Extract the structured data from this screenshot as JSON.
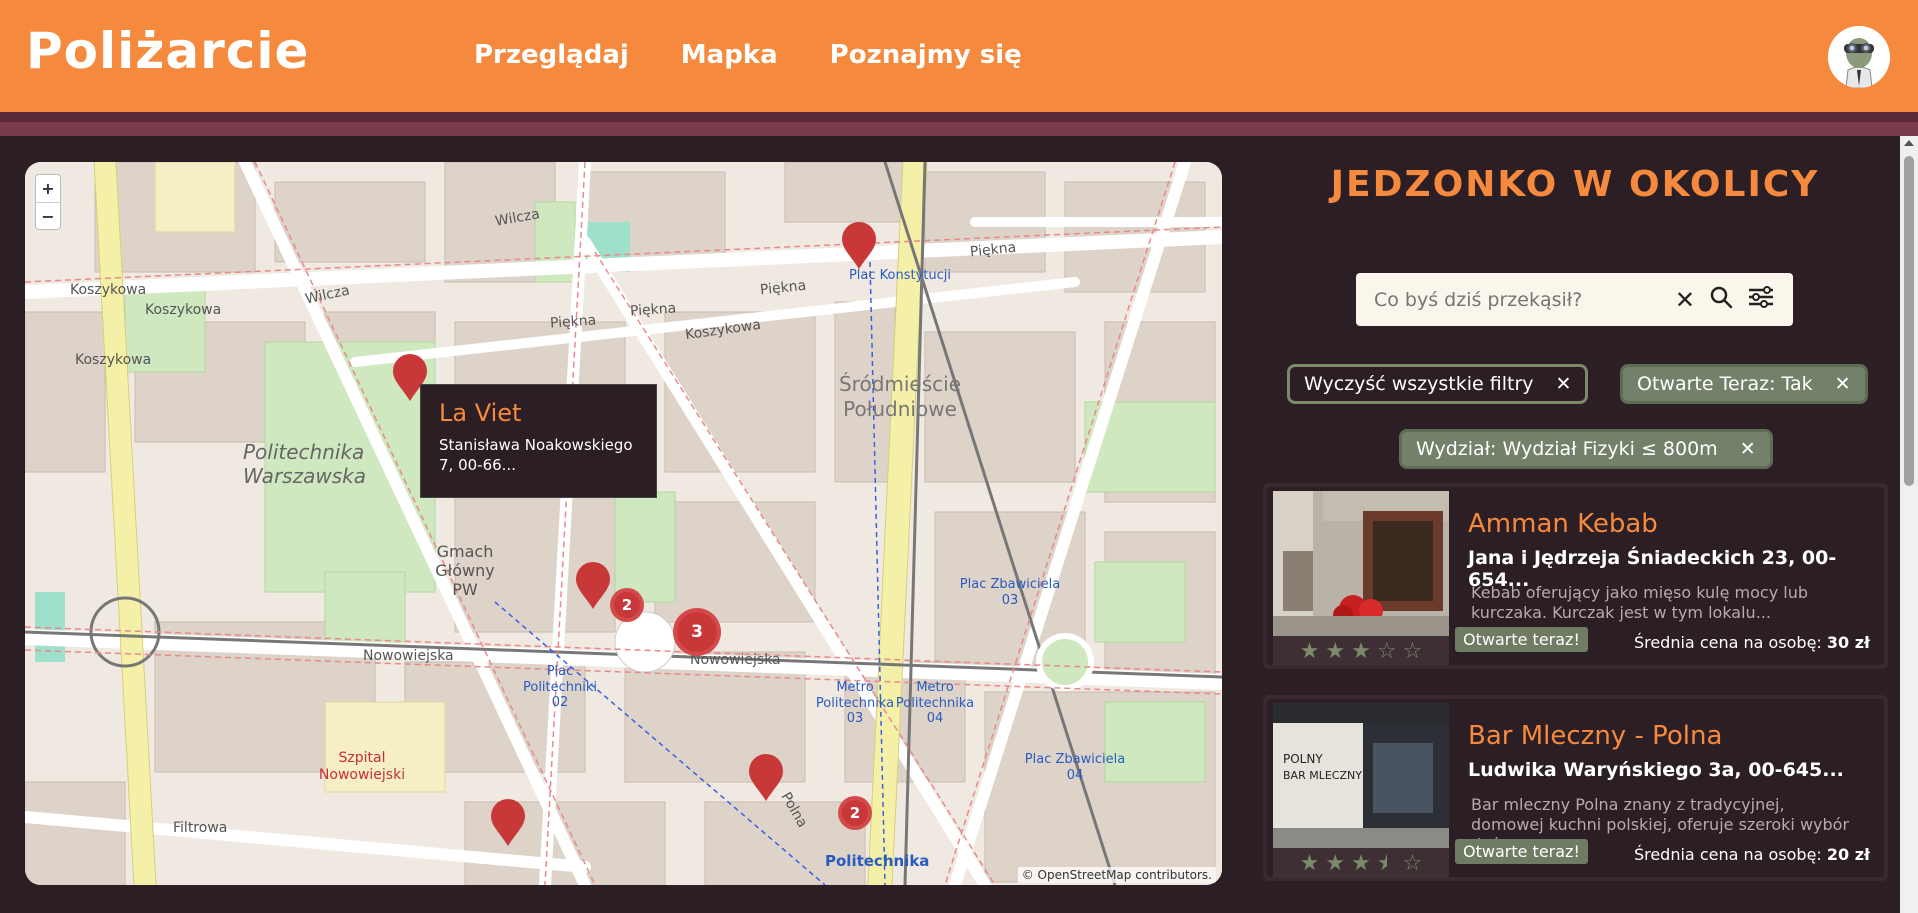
{
  "header": {
    "logo": "Poliżarcie",
    "nav": [
      "Przeglądaj",
      "Mapka",
      "Poznajmy się"
    ]
  },
  "map": {
    "zoom_in": "+",
    "zoom_out": "−",
    "attribution": "© OpenStreetMap contributors.",
    "labels": {
      "koszykowa_1": "Koszykowa",
      "koszykowa_2": "Koszykowa",
      "koszykowa_3": "Koszykowa",
      "koszykowa_4": "Koszykowa",
      "wilcza_1": "Wilcza",
      "wilcza_2": "Wilcza",
      "piekna_1": "Piękna",
      "piekna_2": "Piękna",
      "piekna_3": "Piękna",
      "piekna_4": "Piękna",
      "nowowiejska_1": "Nowowiejska",
      "nowowiejska_2": "Nowowiejska",
      "filtrowa": "Filtrowa",
      "polna": "Polna",
      "politechnika_warszawska": "Politechnika Warszawska",
      "srodmiescie": "Śródmieście Południowe",
      "gmach": "Gmach Główny PW",
      "szpital": "Szpital Nowowiejski",
      "plac_konstytucji": "Plac Konstytucji",
      "plac_zbawiciela_1": "Plac Zbawiciela 03",
      "plac_zbawiciela_2": "Plac Zbawiciela 04",
      "metro_1": "Metro Politechnika 03",
      "metro_2": "Metro Politechnika 04",
      "plac_politechniki": "Plac Politechniki 02",
      "politechnika": "Politechnika"
    },
    "clusters": [
      "2",
      "3",
      "2"
    ],
    "popup": {
      "title": "La Viet",
      "address": "Stanisława Noakowskiego 7, 00-66..."
    }
  },
  "panel": {
    "title": "JEDZONKO W OKOLICY",
    "search_placeholder": "Co byś dziś przekąsił?",
    "chips": {
      "clear": "Wyczyść wszystkie filtry",
      "open_now": "Otwarte Teraz: Tak",
      "faculty": "Wydział: Wydział Fizyki ≤ 800m"
    },
    "cards": [
      {
        "name": "Amman Kebab",
        "address": "Jana i Jędrzeja Śniadeckich 23, 00-654...",
        "description": "Kebab oferujący jako mięso kulę mocy lub kurczaka. Kurczak jest w tym lokalu...",
        "rating": 3,
        "badge": "Otwarte teraz!",
        "price_label": "Średnia cena na osobę: ",
        "price": "30 zł"
      },
      {
        "name": "Bar Mleczny - Polna",
        "address": "Ludwika Waryńskiego 3a, 00-645...",
        "description": "Bar mleczny Polna znany z tradycyjnej, domowej kuchni polskiej, oferuje szeroki wybór dań,...",
        "rating": 3.5,
        "badge": "Otwarte teraz!",
        "price_label": "Średnia cena na osobę: ",
        "price": "20 zł"
      }
    ]
  },
  "colors": {
    "accent": "#f5893d",
    "background": "#2b1e24",
    "chip_green": "#73806a",
    "pin_red": "#c93838"
  }
}
